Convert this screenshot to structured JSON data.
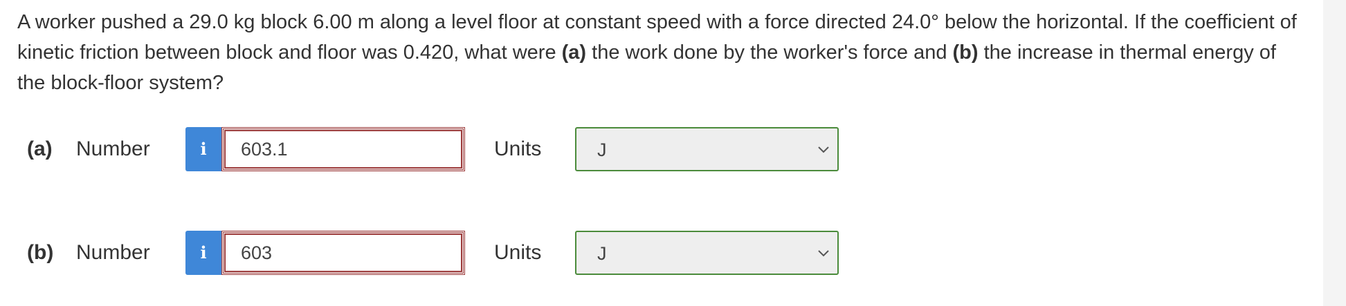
{
  "question": {
    "text_1": "A worker pushed a 29.0 kg block 6.00 m along a level floor at constant speed with a force directed 24.0° below the horizontal. If the coefficient of kinetic friction between block and floor was 0.420, what were ",
    "bold_a": "(a)",
    "text_2": " the work done by the worker's force and ",
    "bold_b": "(b)",
    "text_3": " the increase in thermal energy of the block-floor system?"
  },
  "answers": [
    {
      "part": "(a)",
      "number_label": "Number",
      "info_icon": "i",
      "value": "603.1",
      "units_label": "Units",
      "units_value": "J"
    },
    {
      "part": "(b)",
      "number_label": "Number",
      "info_icon": "i",
      "value": "603",
      "units_label": "Units",
      "units_value": "J"
    }
  ],
  "colors": {
    "info_button": "#3f87d8",
    "input_border": "#9b3a3a",
    "select_border": "#4b8b3b",
    "select_bg": "#eeeeee"
  },
  "icons": {
    "info": "info-icon",
    "dropdown": "chevron-down-icon"
  }
}
